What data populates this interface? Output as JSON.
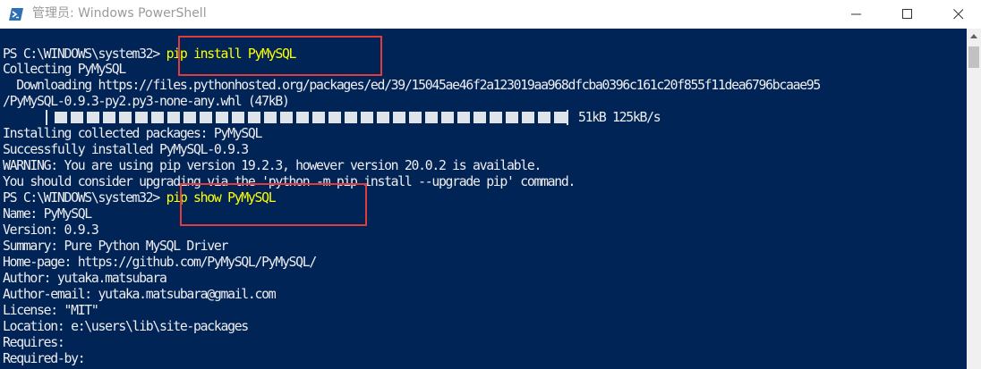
{
  "window": {
    "title": "管理员: Windows PowerShell",
    "controls": {
      "minimize": "minimize-icon",
      "maximize": "maximize-icon",
      "close": "close-icon"
    },
    "app_icon": "powershell-icon"
  },
  "colors": {
    "console_background": "#012456",
    "console_text": "#eeedf0",
    "command_text": "#ffff00",
    "highlight_box": "#e23b3b"
  },
  "console": {
    "lines": [
      {
        "prompt": "PS C:\\WINDOWS\\system32> ",
        "command": "pip install PyMySQL"
      },
      {
        "text": "Collecting PyMySQL"
      },
      {
        "text": "  Downloading https://files.pythonhosted.org/packages/ed/39/15045ae46f2a123019aa968dfcba0396c161c20f855f11dea6796bcaae95"
      },
      {
        "text": "/PyMySQL-0.9.3-py2.py3-none-any.whl (47kB)"
      },
      {
        "progress_stats": "51kB 125kB/s",
        "progress_fraction": 1.0
      },
      {
        "text": "Installing collected packages: PyMySQL"
      },
      {
        "text": "Successfully installed PyMySQL-0.9.3"
      },
      {
        "text": "WARNING: You are using pip version 19.2.3, however version 20.0.2 is available."
      },
      {
        "text": "You should consider upgrading via the 'python -m pip install --upgrade pip' command."
      },
      {
        "prompt": "PS C:\\WINDOWS\\system32> ",
        "command": "pip show PyMySQL"
      },
      {
        "text": "Name: PyMySQL"
      },
      {
        "text": "Version: 0.9.3"
      },
      {
        "text": "Summary: Pure Python MySQL Driver"
      },
      {
        "text": "Home-page: https://github.com/PyMySQL/PyMySQL/"
      },
      {
        "text": "Author: yutaka.matsubara"
      },
      {
        "text": "Author-email: yutaka.matsubara@gmail.com"
      },
      {
        "text": "License: \"MIT\""
      },
      {
        "text": "Location: e:\\users\\lib\\site-packages"
      },
      {
        "text": "Requires:"
      },
      {
        "text": "Required-by:"
      }
    ]
  }
}
